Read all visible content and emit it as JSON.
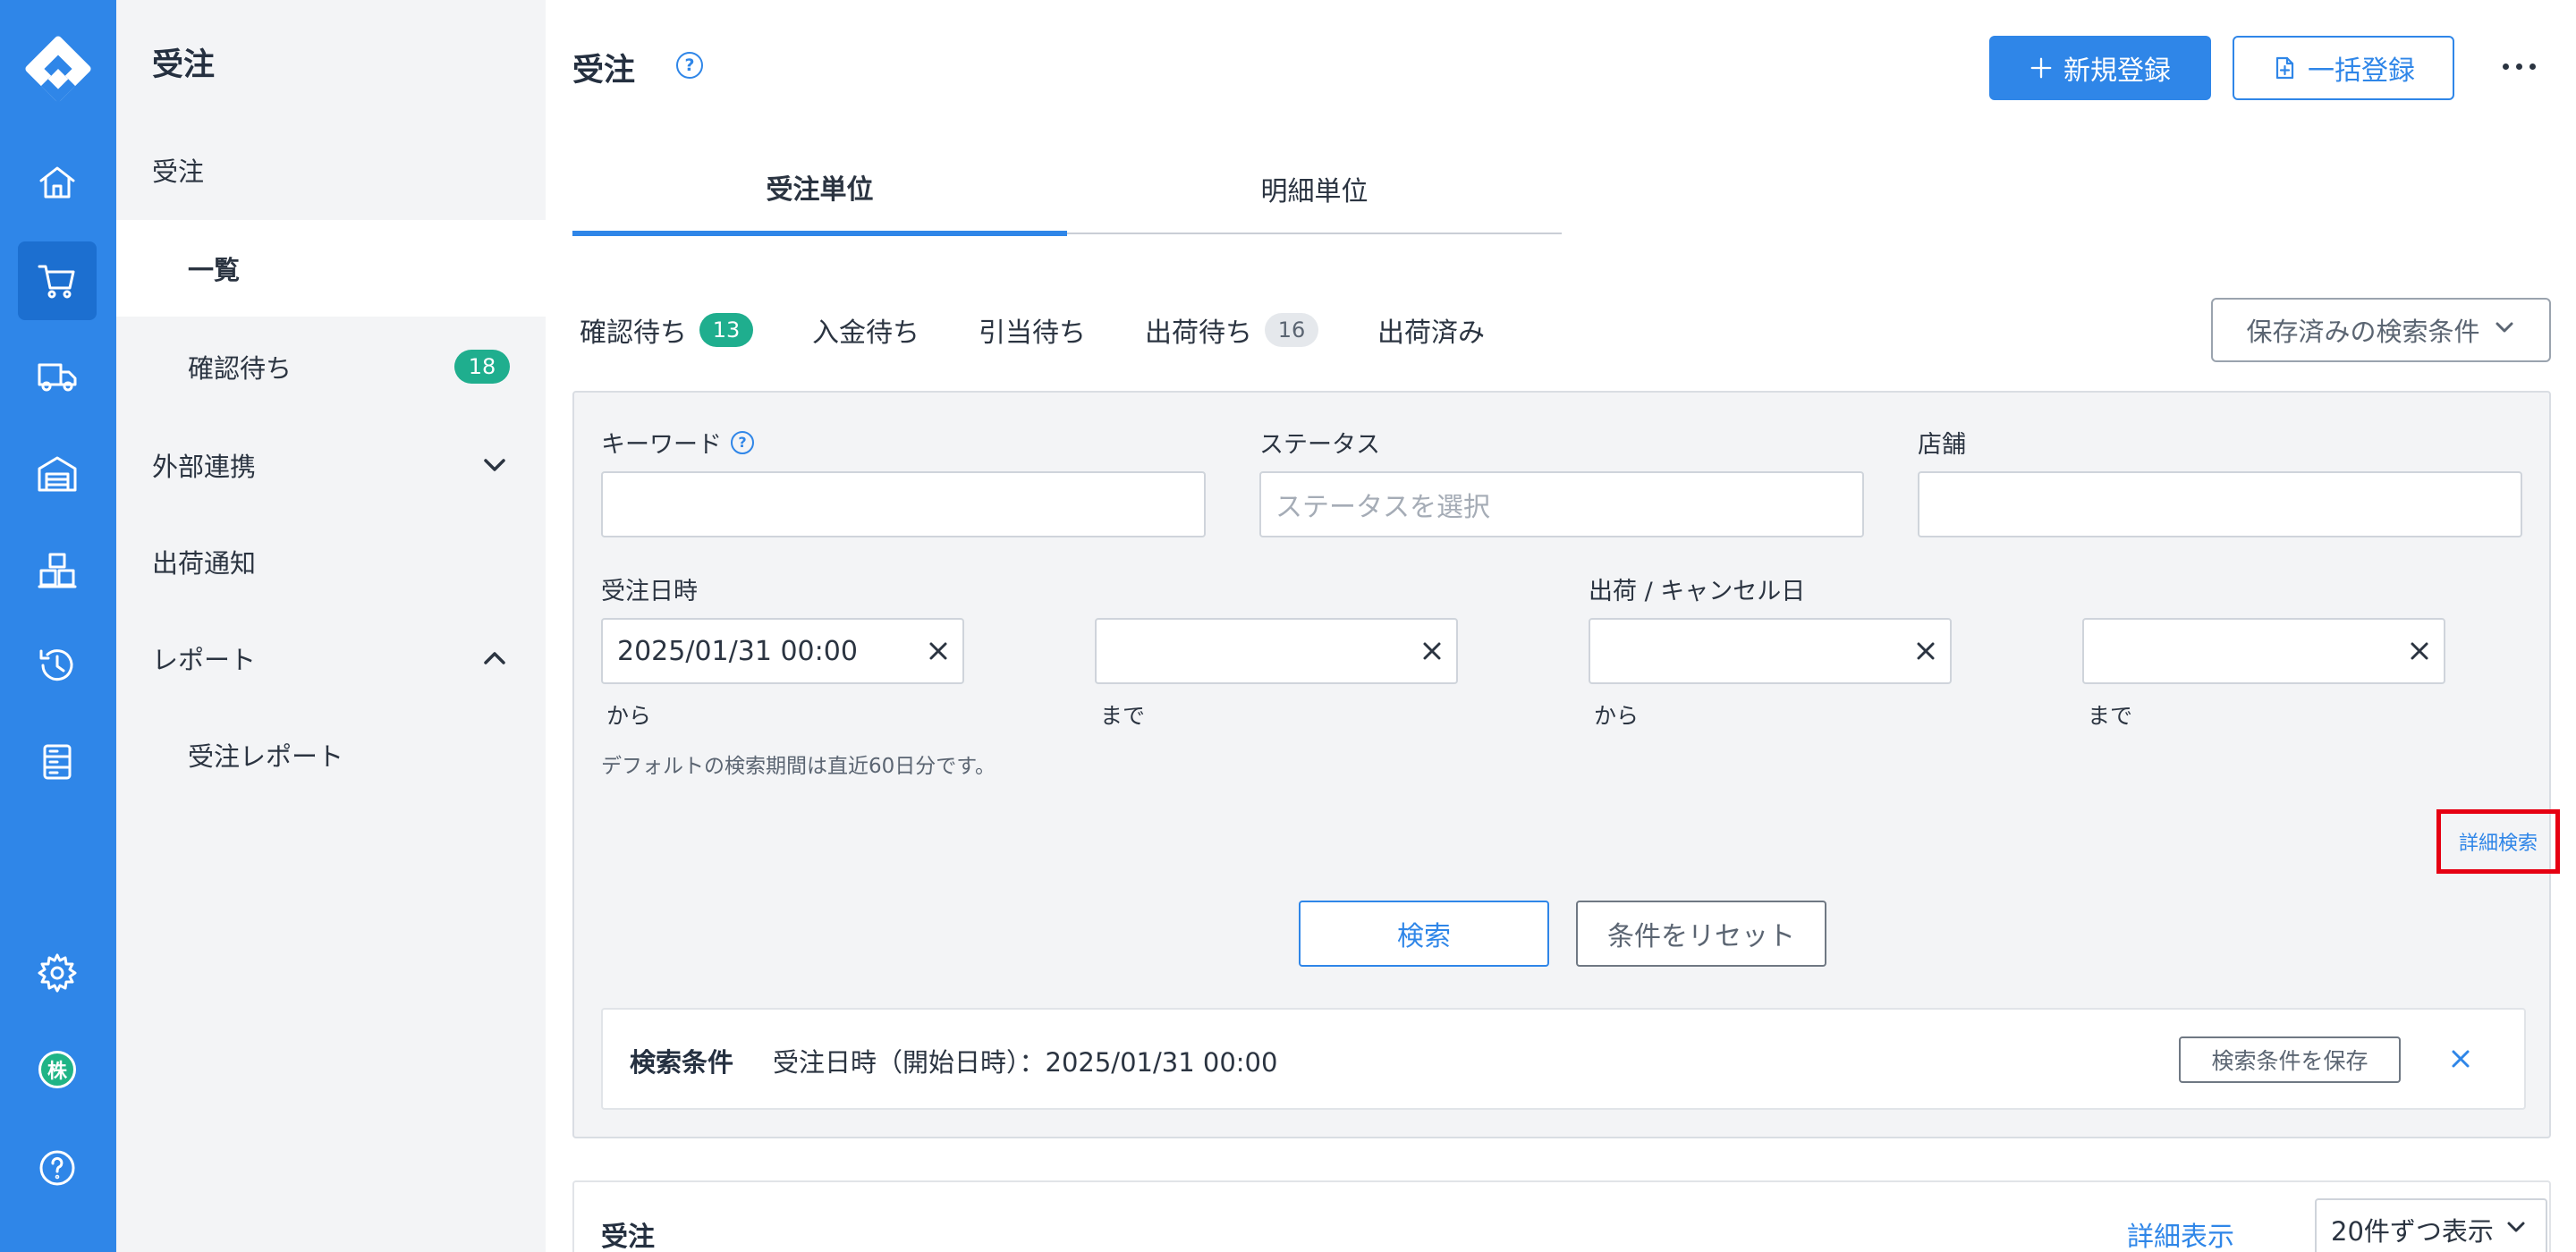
{
  "colors": {
    "brand": "#2f86e8",
    "badge_green": "#1fae8e",
    "highlight_red": "#e60012"
  },
  "rail": {
    "icons": [
      "logo-icon",
      "home-icon",
      "cart-icon",
      "truck-icon",
      "warehouse-icon",
      "boxes-icon",
      "history-icon",
      "server-icon",
      "gear-icon",
      "avatar",
      "help-icon"
    ],
    "avatar_text": "株",
    "help_text": "?"
  },
  "sidenav": {
    "title": "受注",
    "items": [
      {
        "label": "受注"
      },
      {
        "label": "一覧"
      },
      {
        "label": "確認待ち",
        "badge": "18"
      },
      {
        "label": "外部連携"
      },
      {
        "label": "出荷通知"
      },
      {
        "label": "レポート"
      },
      {
        "label": "受注レポート"
      }
    ]
  },
  "header": {
    "title": "受注",
    "help": "?",
    "new_label": "新規登録",
    "bulk_label": "一括登録"
  },
  "tabs": [
    {
      "label": "受注単位"
    },
    {
      "label": "明細単位"
    }
  ],
  "status_tabs": [
    {
      "label": "確認待ち",
      "count": "13"
    },
    {
      "label": "入金待ち"
    },
    {
      "label": "引当待ち"
    },
    {
      "label": "出荷待ち",
      "count": "16"
    },
    {
      "label": "出荷済み"
    }
  ],
  "saved_search_label": "保存済みの検索条件",
  "filters": {
    "keyword_label": "キーワード",
    "keyword_help": "?",
    "keyword_value": "",
    "status_label": "ステータス",
    "status_placeholder": "ステータスを選択",
    "store_label": "店舗",
    "store_value": "",
    "order_date_label": "受注日時",
    "order_date_from": "2025/01/31 00:00",
    "order_date_to": "",
    "ship_date_label": "出荷 / キャンセル日",
    "ship_date_from": "",
    "ship_date_to": "",
    "from_text": "から",
    "to_text": "まで",
    "note": "デフォルトの検索期間は直近60日分です。",
    "advanced_link": "詳細検索",
    "search_button": "検索",
    "reset_button": "条件をリセット"
  },
  "conditions": {
    "title": "検索条件",
    "text": "受注日時（開始日時）：2025/01/31 00:00",
    "save_button": "検索条件を保存"
  },
  "results": {
    "title": "受注",
    "detail_link": "詳細表示",
    "per_page": "20件ずつ表示"
  }
}
